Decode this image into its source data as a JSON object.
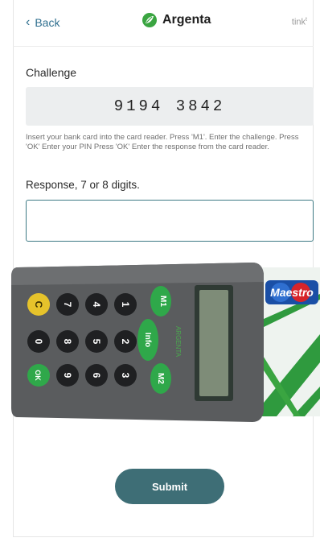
{
  "header": {
    "back_label": "Back",
    "brand_name": "Argenta",
    "provider": "tink"
  },
  "challenge": {
    "label": "Challenge",
    "code": "9194 3842"
  },
  "instructions": "Insert your bank card into the card reader. Press 'M1'. Enter the challenge. Press 'OK' Enter your PIN Press 'OK' Enter the response from the card reader.",
  "response": {
    "label": "Response, 7 or 8 digits.",
    "value": "",
    "placeholder": ""
  },
  "card_reader": {
    "keys_row1": [
      "C",
      "7",
      "4",
      "1"
    ],
    "keys_row2": [
      "0",
      "8",
      "5",
      "2"
    ],
    "keys_row3": [
      "OK",
      "9",
      "6",
      "3"
    ],
    "function_keys": [
      "M1",
      "Info",
      "M2"
    ],
    "reader_brand": "ARGENTA",
    "card_brand": "Maestro"
  },
  "colors": {
    "accent": "#3e6e76",
    "link": "#2f6f8f",
    "brand_green": "#3aa541",
    "key_yellow": "#e6c32b",
    "key_green": "#2fa84a"
  },
  "submit_label": "Submit"
}
